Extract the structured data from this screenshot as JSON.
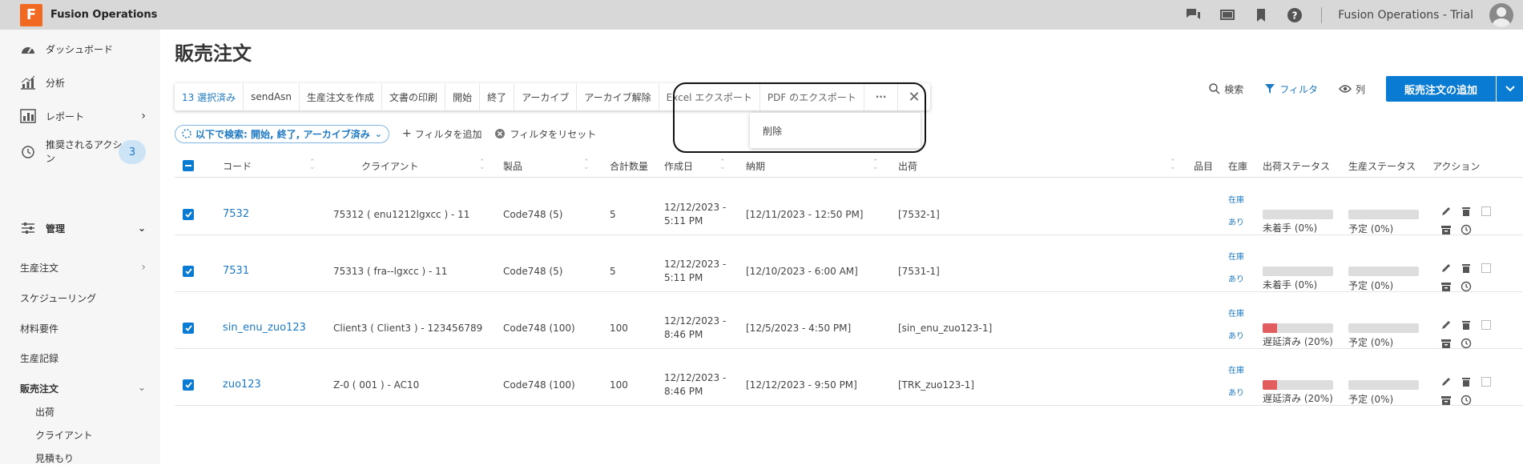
{
  "app": {
    "logo_letter": "F",
    "name": "Fusion Operations",
    "account": "Fusion Operations - Trial"
  },
  "sidebar": {
    "dashboard": "ダッシュボード",
    "analytics": "分析",
    "reports": "レポート",
    "recommended": "推奨されるアクショ\nン",
    "recommended_count": "3",
    "admin": "管理",
    "production_orders": "生産注文",
    "scheduling": "スケジューリング",
    "material_requirements": "材料要件",
    "production_records": "生産記録",
    "sales_orders": "販売注文",
    "shipments": "出荷",
    "clients": "クライアント",
    "quotes": "見積もり"
  },
  "page": {
    "title": "販売注文"
  },
  "actionbar": {
    "selected": "13 選択済み",
    "send_asn": "sendAsn",
    "create_production": "生産注文を作成",
    "print_docs": "文書の印刷",
    "start": "開始",
    "finish": "終了",
    "archive": "アーカイブ",
    "unarchive": "アーカイブ解除",
    "excel_export": "Excel エクスポート",
    "pdf_export": "PDF のエクスポート",
    "more": "···",
    "close": "✕"
  },
  "dropdown": {
    "delete": "削除"
  },
  "tools": {
    "search": "検索",
    "filter": "フィルタ",
    "columns": "列",
    "add_order": "販売注文の追加"
  },
  "filters": {
    "chip": "以下で検索: 開始, 終了, アーカイブ済み",
    "add_filter": "フィルタを追加",
    "reset_filter": "フィルタをリセット"
  },
  "columns": {
    "code": "コード",
    "client": "クライアント",
    "product": "製品",
    "total_qty": "合計数量",
    "created": "作成日",
    "due": "納期",
    "shipment": "出荷",
    "item": "品目",
    "stock": "在庫",
    "ship_status": "出荷ステータス",
    "prod_status": "生産ステータス",
    "actions": "アクション"
  },
  "rows": [
    {
      "code": "7532",
      "client": "75312 ( enu1212lgxcc ) - 11",
      "product": "Code748 (5)",
      "qty": "5",
      "created1": "12/12/2023 -",
      "created2": "5:11 PM",
      "due": "[12/11/2023 - 12:50 PM]",
      "shipment": "[7532-1]",
      "stock1": "在庫",
      "stock2": "あり",
      "ship_status": "未着手 (0%)",
      "ship_pct": 0,
      "prod_status": "予定 (0%)",
      "prod_pct": 0
    },
    {
      "code": "7531",
      "client": "75313 ( fra--lgxcc ) - 11",
      "product": "Code748 (5)",
      "qty": "5",
      "created1": "12/12/2023 -",
      "created2": "5:11 PM",
      "due": "[12/10/2023 - 6:00 AM]",
      "shipment": "[7531-1]",
      "stock1": "在庫",
      "stock2": "あり",
      "ship_status": "未着手 (0%)",
      "ship_pct": 0,
      "prod_status": "予定 (0%)",
      "prod_pct": 0
    },
    {
      "code": "sin_enu_zuo123",
      "client": "Client3 ( Client3 ) - 123456789",
      "product": "Code748 (100)",
      "qty": "100",
      "created1": "12/12/2023 -",
      "created2": "8:46 PM",
      "due": "[12/5/2023 - 4:50 PM]",
      "shipment": "[sin_enu_zuo123-1]",
      "stock1": "在庫",
      "stock2": "あり",
      "ship_status": "遅延済み (20%)",
      "ship_pct": 20,
      "prod_status": "予定 (0%)",
      "prod_pct": 0
    },
    {
      "code": "zuo123",
      "client": "Z-0 ( 001 ) - AC10",
      "product": "Code748 (100)",
      "qty": "100",
      "created1": "12/12/2023 -",
      "created2": "8:46 PM",
      "due": "[12/12/2023 - 9:50 PM]",
      "shipment": "[TRK_zuo123-1]",
      "stock1": "在庫",
      "stock2": "あり",
      "ship_status": "遅延済み (20%)",
      "ship_pct": 20,
      "prod_status": "予定 (0%)",
      "prod_pct": 0
    }
  ],
  "colors": {
    "accent": "#0a7bd3",
    "link": "#1e79c3",
    "late": "#e25d5d",
    "brand": "#f26a21"
  }
}
